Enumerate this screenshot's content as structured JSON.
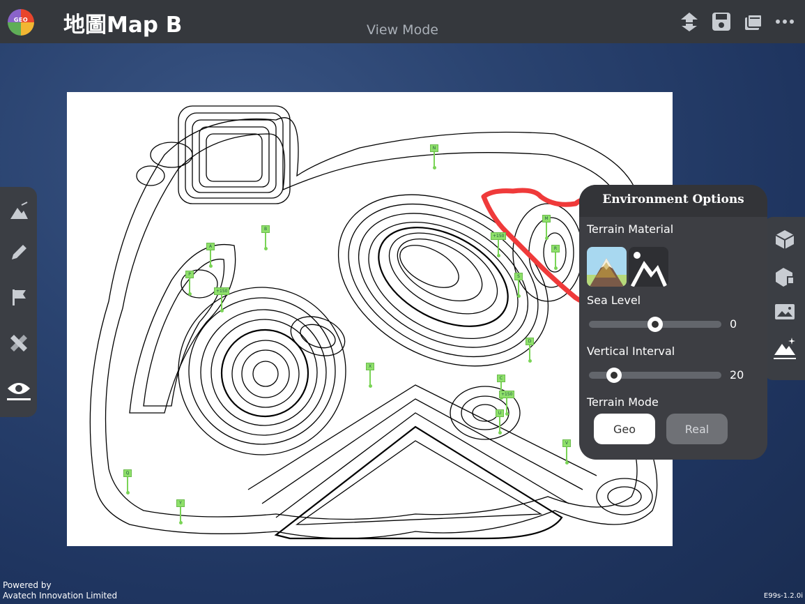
{
  "app": {
    "logo_text": "GEO",
    "title": "地圖Map B",
    "mode": "View Mode"
  },
  "toolbar_icons": [
    "upload-download-icon",
    "save-icon",
    "layers-icon",
    "more-icon"
  ],
  "left_tools": [
    "terrain-tool-icon",
    "pencil-icon",
    "flag-icon",
    "measure-icon",
    "eye-icon"
  ],
  "right_tools": [
    "box-icon",
    "rotate-box-icon",
    "image-icon",
    "terrain-sparkle-icon"
  ],
  "map": {
    "markers": [
      {
        "label": "N"
      },
      {
        "label": "B"
      },
      {
        "label": "A"
      },
      {
        "label": "P"
      },
      {
        "label": "+150"
      },
      {
        "label": "+150"
      },
      {
        "label": "M"
      },
      {
        "label": "R"
      },
      {
        "label": "S"
      },
      {
        "label": "D"
      },
      {
        "label": "X"
      },
      {
        "label": "C"
      },
      {
        "label": "+150"
      },
      {
        "label": "U"
      },
      {
        "label": "V"
      },
      {
        "label": "Q"
      },
      {
        "label": "Y"
      }
    ],
    "highlight_color": "#ef3a3a"
  },
  "environment": {
    "title": "Environment Options",
    "terrain_material_label": "Terrain Material",
    "materials": [
      "realistic-mountain",
      "geo-mountain"
    ],
    "sea_level": {
      "label": "Sea Level",
      "value": "0",
      "fraction": 0.5
    },
    "vertical_interval": {
      "label": "Vertical Interval",
      "value": "20",
      "fraction": 0.19
    },
    "terrain_mode_label": "Terrain Mode",
    "modes": [
      {
        "label": "Geo",
        "selected": true
      },
      {
        "label": "Real",
        "selected": false
      }
    ]
  },
  "footer": {
    "powered_line1": "Powered by",
    "powered_line2": "Avatech Innovation Limited",
    "version": "E99s-1.2.0i"
  }
}
